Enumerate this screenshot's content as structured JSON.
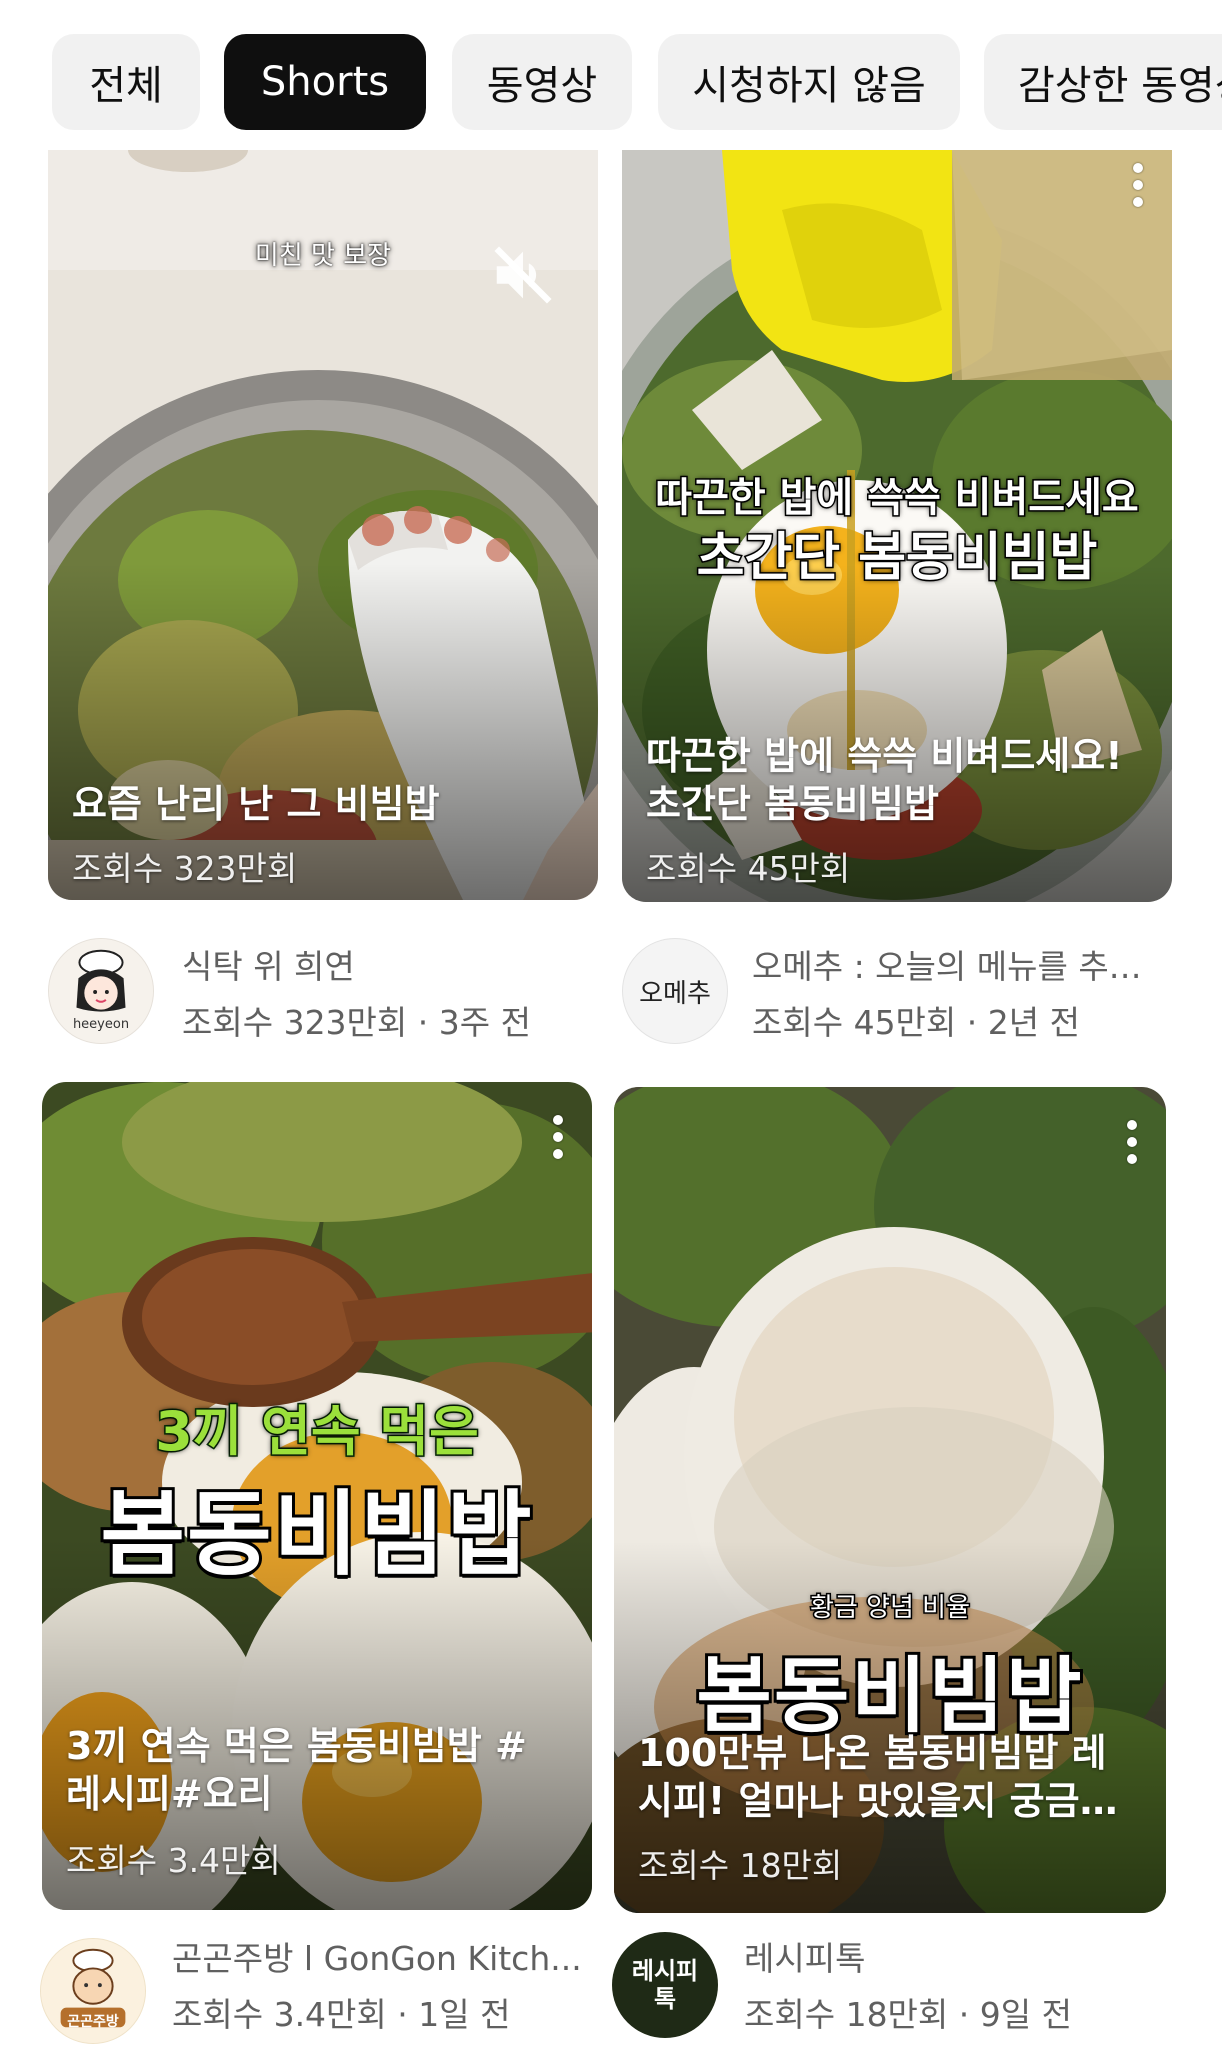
{
  "chips": [
    {
      "label": "전체",
      "active": false
    },
    {
      "label": "Shorts",
      "active": true
    },
    {
      "label": "동영상",
      "active": false
    },
    {
      "label": "시청하지 않음",
      "active": false
    },
    {
      "label": "감상한 동영상",
      "active": false
    }
  ],
  "cards": [
    {
      "thumb_title": "요즘 난리 난 그 비빔밥",
      "thumb_views": "조회수 323만회",
      "overlay_top": "미친 맛 보장",
      "channel": "식탁 위 희연",
      "avatar_text": "heeyeon",
      "meta": "조회수 323만회 · 3주 전",
      "muted_icon": "volume-off-icon"
    },
    {
      "thumb_title": "따끈한 밥에 쓱쓱 비벼드세요! 초간단 봄동비빔밥",
      "thumb_views": "조회수 45만회",
      "overlay_line1": "따끈한 밥에 쓱쓱 비벼드세요",
      "overlay_line2": "초간단 봄동비빔밥",
      "channel": "오메추 : 오늘의 메뉴를 추…",
      "avatar_text": "오메추",
      "meta": "조회수 45만회 · 2년 전"
    },
    {
      "thumb_title": "3끼 연속 먹은 봄동비빔밥 # 레시피#요리",
      "thumb_views": "조회수 3.4만회",
      "overlay_green": "3끼 연속 먹은",
      "overlay_big": "봄동비빔밥",
      "channel": "곤곤주방 l GonGon Kitch...",
      "avatar_text": "곤곤주방",
      "meta": "조회수 3.4만회 · 1일 전"
    },
    {
      "thumb_title": "100만뷰 나온 봄동비빔밥 레시피! 얼마나 맛있을지 궁금…",
      "thumb_views": "조회수 18만회",
      "overlay_small": "황금 양념 비율",
      "overlay_big": "봄동비빔밥",
      "channel": "레시피톡",
      "avatar_text": "레시피톡",
      "meta": "조회수 18만회 · 9일 전"
    }
  ],
  "colors": {
    "chip_bg": "#f1f1f1",
    "chip_active_bg": "#0f0f0f",
    "meta_text": "#606060"
  }
}
